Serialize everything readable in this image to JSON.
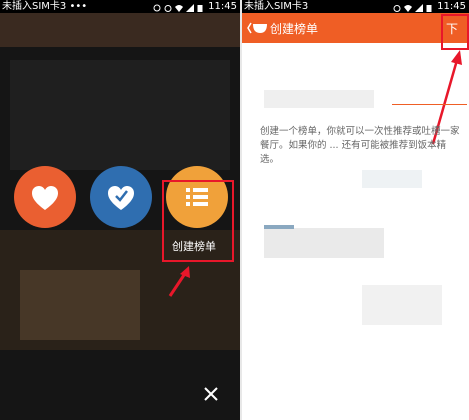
{
  "left_screen": {
    "status_bar": {
      "carrier": "未插入SIM卡3",
      "dots": "•••",
      "time": "11:45"
    },
    "actions": [
      {
        "name": "like",
        "color": "#ea5f31"
      },
      {
        "name": "recommend",
        "color": "#2f6eb0"
      },
      {
        "name": "create-list",
        "color": "#f0a13a",
        "label": "创建榜单"
      }
    ],
    "close_glyph": "×"
  },
  "right_screen": {
    "status_bar": {
      "carrier": "未插入SIM卡3",
      "time": "11:45"
    },
    "header": {
      "title": "创建榜单",
      "next_label": "下一",
      "accent": "#ef5e25"
    },
    "description": "创建一个榜单，你就可以一次性推荐或吐槽一家餐厅。如果你的 ... 还有可能被推荐到饭本精选。"
  },
  "colors": {
    "highlight_box": "#e8172a",
    "arrow": "#e8172a"
  }
}
